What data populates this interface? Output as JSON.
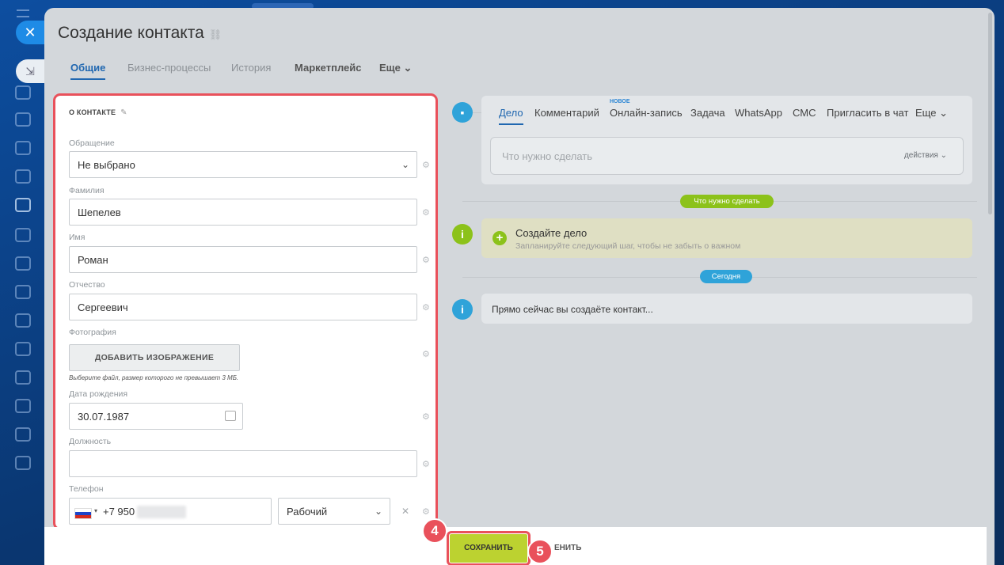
{
  "window": {
    "title": "Создание контакта"
  },
  "tabs": [
    "Общие",
    "Бизнес-процессы",
    "История",
    "Маркетплейс",
    "Еще"
  ],
  "card": {
    "header": "О КОНТАКТЕ",
    "fields": {
      "salutation_label": "Обращение",
      "salutation_value": "Не выбрано",
      "lastname_label": "Фамилия",
      "lastname_value": "Шепелев",
      "firstname_label": "Имя",
      "firstname_value": "Роман",
      "patronymic_label": "Отчество",
      "patronymic_value": "Сергеевич",
      "photo_label": "Фотография",
      "photo_button": "ДОБАВИТЬ ИЗОБРАЖЕНИЕ",
      "photo_hint": "Выберите файл, размер которого не превышает 3 МБ.",
      "birthday_label": "Дата рождения",
      "birthday_value": "30.07.1987",
      "position_label": "Должность",
      "position_value": "",
      "phone_label": "Телефон",
      "phone_value": "+7 950",
      "phone_type": "Рабочий"
    }
  },
  "timeline": {
    "tabs": [
      "Дело",
      "Комментарий",
      "Онлайн-запись",
      "Задача",
      "WhatsApp",
      "СМС",
      "Пригласить в чат",
      "Еще"
    ],
    "new_badge": "НОВОЕ",
    "todo_placeholder": "Что нужно сделать",
    "todo_actions": "действия",
    "pill_todo": "Что нужно сделать",
    "create_title": "Создайте дело",
    "create_sub": "Запланируйте следующий шаг, чтобы не забыть о важном",
    "pill_today": "Сегодня",
    "now_text": "Прямо сейчас вы создаёте контакт..."
  },
  "footer": {
    "save": "СОХРАНИТЬ",
    "cancel": "ЕНИТЬ"
  },
  "steps": [
    "4",
    "5"
  ],
  "colors": {
    "accent": "#2067b0",
    "save": "#bcd230",
    "highlight": "#e9515b",
    "pill_green": "#8cc21a",
    "pill_blue": "#2fa3d9"
  }
}
